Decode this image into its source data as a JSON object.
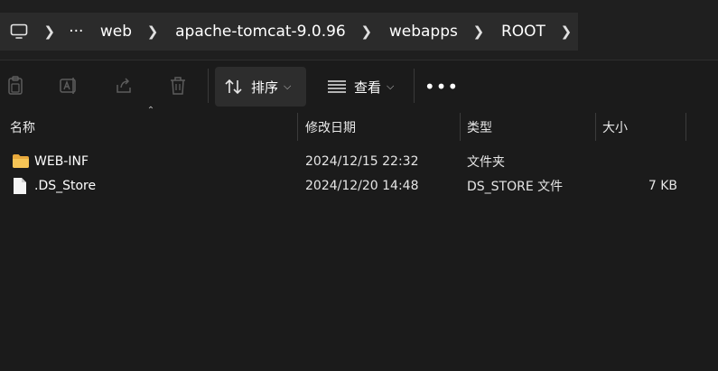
{
  "address_bar": {
    "crumbs": [
      "web",
      "apache-tomcat-9.0.96",
      "webapps",
      "ROOT"
    ],
    "overflow_label": "···",
    "root_icon": "computer-icon"
  },
  "toolbar": {
    "icons": [
      "clipboard-icon",
      "rename-icon",
      "share-icon",
      "delete-icon"
    ],
    "sort_label": "排序",
    "view_label": "查看",
    "more_label": "•••"
  },
  "columns": {
    "name": "名称",
    "modified": "修改日期",
    "type": "类型",
    "size": "大小"
  },
  "files": [
    {
      "name": "WEB-INF",
      "modified": "2024/12/15 22:32",
      "type": "文件夹",
      "size": "",
      "icon": "folder-icon"
    },
    {
      "name": ".DS_Store",
      "modified": "2024/12/20 14:48",
      "type": "DS_STORE 文件",
      "size": "7 KB",
      "icon": "file-icon"
    }
  ],
  "colors": {
    "background": "#1b1b1b",
    "address_bg": "#2b2b2b",
    "folder": "#f2c14e"
  }
}
